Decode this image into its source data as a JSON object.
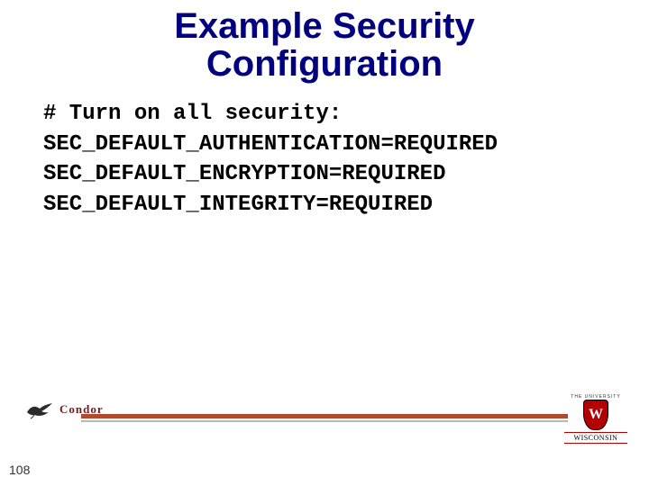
{
  "title_line1": "Example Security",
  "title_line2": "Configuration",
  "config": {
    "line1": "# Turn on all security:",
    "line2": "SEC_DEFAULT_AUTHENTICATION=REQUIRED",
    "line3": "SEC_DEFAULT_ENCRYPTION=REQUIRED",
    "line4": "SEC_DEFAULT_INTEGRITY=REQUIRED"
  },
  "footer": {
    "condor_label": "Condor",
    "wisconsin_top": "THE UNIVERSITY",
    "wisconsin_label": "WISCONSIN",
    "crest_letter": "W"
  },
  "slide_number": "108"
}
